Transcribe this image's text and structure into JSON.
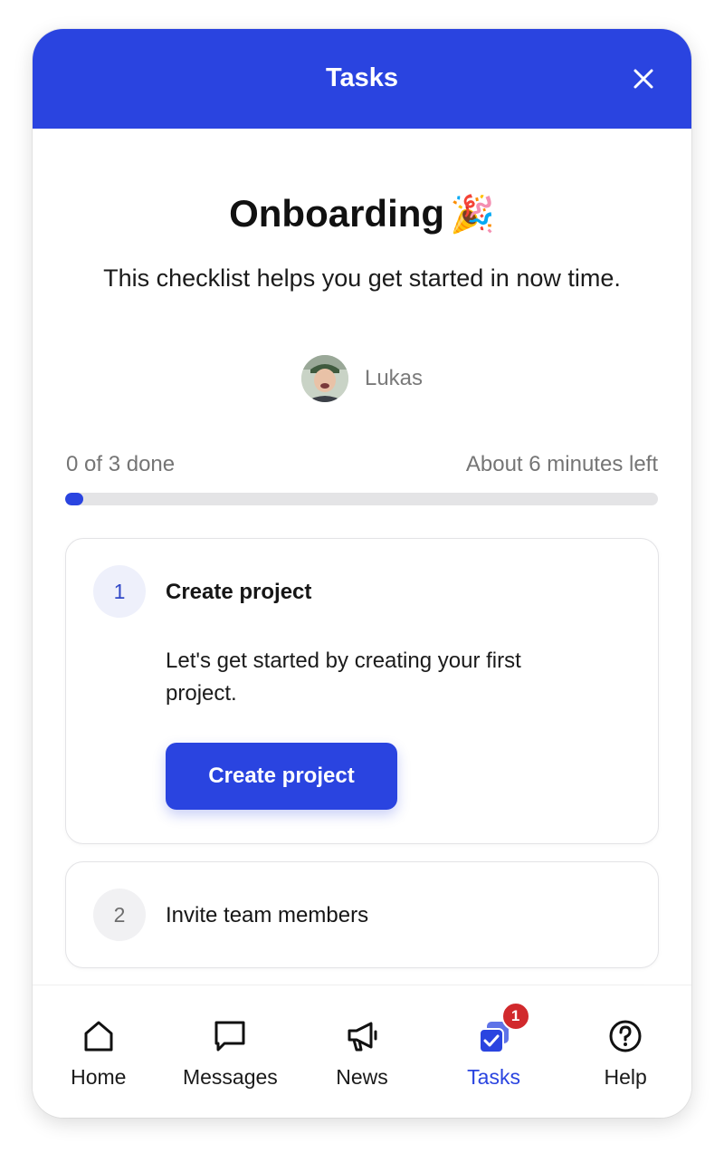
{
  "header": {
    "title": "Tasks",
    "close_icon": "close-icon",
    "background_color": "#2a44e0"
  },
  "checklist": {
    "title": "Onboarding",
    "title_emoji": "🎉",
    "subtitle": "This checklist helps you get started in now time.",
    "author": {
      "name": "Lukas",
      "avatar": "avatar-photo"
    },
    "progress": {
      "done_label": "0 of 3 done",
      "time_left_label": "About 6 minutes left",
      "fraction": 0.03
    }
  },
  "tasks": [
    {
      "number": "1",
      "title": "Create project",
      "description": "Let's get started by creating your first project.",
      "button_label": "Create project",
      "expanded": true
    },
    {
      "number": "2",
      "title": "Invite team members",
      "expanded": false
    }
  ],
  "nav": {
    "items": [
      {
        "label": "Home",
        "icon": "home-icon",
        "active": false
      },
      {
        "label": "Messages",
        "icon": "chat-bubble-icon",
        "active": false
      },
      {
        "label": "News",
        "icon": "megaphone-icon",
        "active": false
      },
      {
        "label": "Tasks",
        "icon": "tasks-icon",
        "active": true,
        "badge": "1"
      },
      {
        "label": "Help",
        "icon": "help-circle-icon",
        "active": false
      }
    ]
  },
  "colors": {
    "accent": "#2a44e0",
    "badge": "#d1292c"
  }
}
